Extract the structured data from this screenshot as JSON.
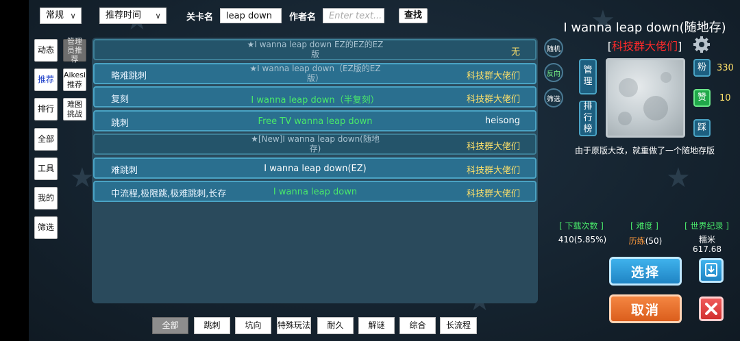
{
  "filters": {
    "category_select": "常规",
    "sort_select": "推荐时间",
    "level_name_label": "关卡名",
    "level_name_value": "leap down",
    "author_label": "作者名",
    "author_placeholder": "Enter text...",
    "search_button": "查找"
  },
  "sidebar": {
    "items": [
      "动态",
      "推荐",
      "排行",
      "全部",
      "工具",
      "我的",
      "筛选"
    ],
    "sub_items": [
      "管理员推荐",
      "Aikesi推荐",
      "难图挑战"
    ]
  },
  "list": [
    {
      "tag": "",
      "title": "★I wanna leap down EZ的EZ的EZ版",
      "author": "无"
    },
    {
      "tag": "略难跳刺",
      "title": "★I wanna leap down（EZ版的EZ版）",
      "author": "科技群大佬们"
    },
    {
      "tag": "复刻",
      "title": "I wanna leap down（半复刻）",
      "author": "科技群大佬们"
    },
    {
      "tag": "跳刺",
      "title": "Free TV wanna leap down",
      "author": "heisong"
    },
    {
      "tag": "",
      "title": "★[New]I wanna leap down(随地存)",
      "author": "科技群大佬们"
    },
    {
      "tag": "难跳刺",
      "title": "I wanna leap down(EZ)",
      "author": "科技群大佬们"
    },
    {
      "tag": "中流程,极限跳,极难跳刺,长存",
      "title": "I wanna leap down",
      "author": "科技群大佬们"
    }
  ],
  "side_controls": {
    "random": "随机",
    "reverse": "反向",
    "filter": "筛选"
  },
  "categories": [
    "全部",
    "跳刺",
    "坑向",
    "特殊玩法",
    "耐久",
    "解谜",
    "综合",
    "长流程"
  ],
  "detail": {
    "title": "I wanna leap down(随地存)",
    "author_prefix": "[",
    "author": "科技群大佬们",
    "author_suffix": "]",
    "manage_button": "管理",
    "ranking_button": "排行榜",
    "fans_label": "粉",
    "fans_count": "330",
    "like_label": "赞",
    "like_count": "10",
    "dislike_label": "踩",
    "description": "由于原版大改，就重做了一个随地存版",
    "stats": {
      "downloads_label": "[ 下载次数 ]",
      "downloads_value": "410(5.85%)",
      "difficulty_label": "[ 难度 ]",
      "difficulty_name": "历练",
      "difficulty_value": "(50)",
      "record_label": "[ 世界纪录 ]",
      "record_holder": "糯米",
      "record_time": "617.68"
    },
    "select_button": "选择",
    "cancel_button": "取消"
  },
  "colors": {
    "author_red": "#ff2a2a",
    "difficulty_orange": "#ff9a3c",
    "author_yellow": "#ffe16a",
    "tag_green": "#49e86a"
  }
}
